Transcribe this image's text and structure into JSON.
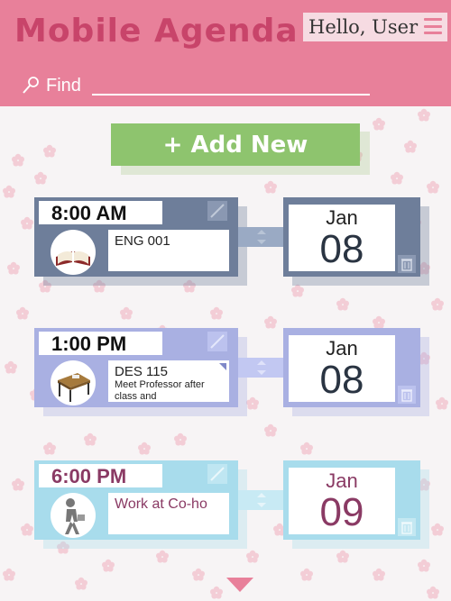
{
  "header": {
    "title": "Mobile Agenda",
    "greeting": "Hello, User",
    "search_label": "Find",
    "search_value": "",
    "search_placeholder": ""
  },
  "actions": {
    "add_label": "+ Add New"
  },
  "colors": {
    "header": "#e8809a",
    "title": "#c8446a",
    "add_button": "#8ec46e"
  },
  "events": [
    {
      "time": "8:00 AM",
      "title": "ENG 001",
      "note": "",
      "month": "Jan",
      "day": "08",
      "icon": "book-icon",
      "color": "#6e7e9a"
    },
    {
      "time": "1:00 PM",
      "title": "DES 115",
      "note": "Meet Professor after class and",
      "month": "Jan",
      "day": "08",
      "icon": "desk-icon",
      "color": "#a9b0e2"
    },
    {
      "time": "6:00 PM",
      "title": "Work at Co-ho",
      "note": "",
      "month": "Jan",
      "day": "09",
      "icon": "walking-person-icon",
      "color": "#a8dcec"
    }
  ]
}
